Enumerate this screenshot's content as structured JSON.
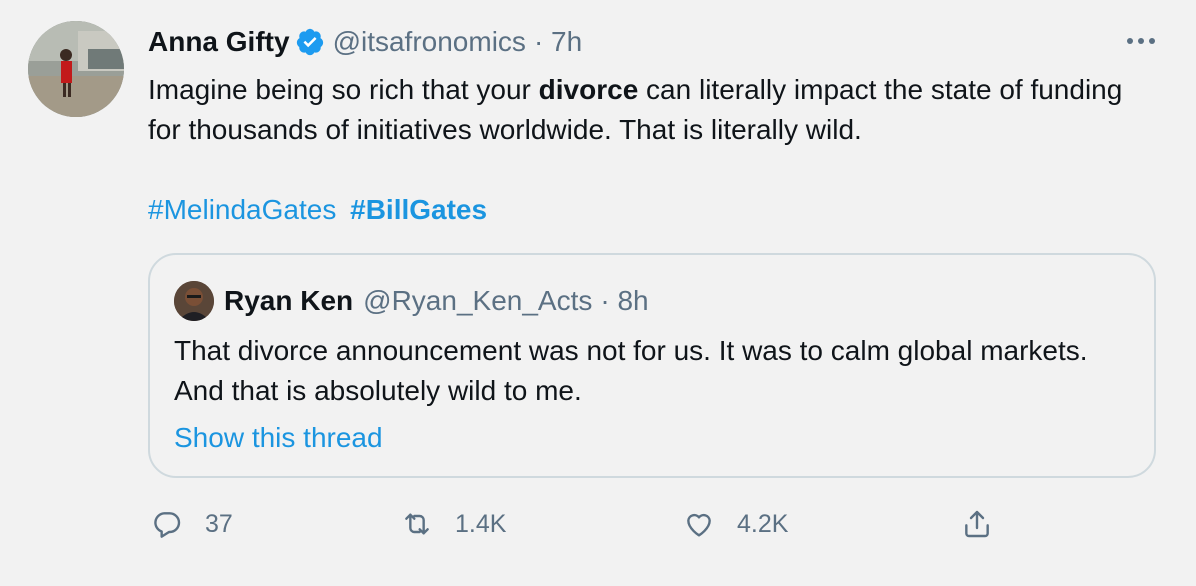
{
  "tweet": {
    "author": {
      "name": "Anna Gifty",
      "handle": "@itsafronomics",
      "time": "· 7h"
    },
    "text_before": "Imagine being so rich that your ",
    "text_bold": "divorce",
    "text_after": " can literally impact the state of funding for thousands of initiatives worldwide. That is literally wild.",
    "hashtags": [
      "#MelindaGates",
      "#BillGates"
    ],
    "more_icon": "more-horizontal-icon"
  },
  "quote": {
    "author": {
      "name": "Ryan Ken",
      "handle": "@Ryan_Ken_Acts",
      "time": "· 8h"
    },
    "text": "That divorce announcement was not for us. It was to calm global markets. And that is absolutely wild to me.",
    "show_thread": "Show this thread"
  },
  "actions": {
    "reply": {
      "icon": "reply-icon",
      "count": "37"
    },
    "retweet": {
      "icon": "retweet-icon",
      "count": "1.4K"
    },
    "like": {
      "icon": "heart-icon",
      "count": "4.2K"
    },
    "share": {
      "icon": "share-icon"
    }
  },
  "colors": {
    "background": "#f2f2f2",
    "text": "#0f1419",
    "muted": "#5b7083",
    "link": "#1b95e0",
    "verified": "#1d9bf0",
    "border": "#cfd9de"
  }
}
